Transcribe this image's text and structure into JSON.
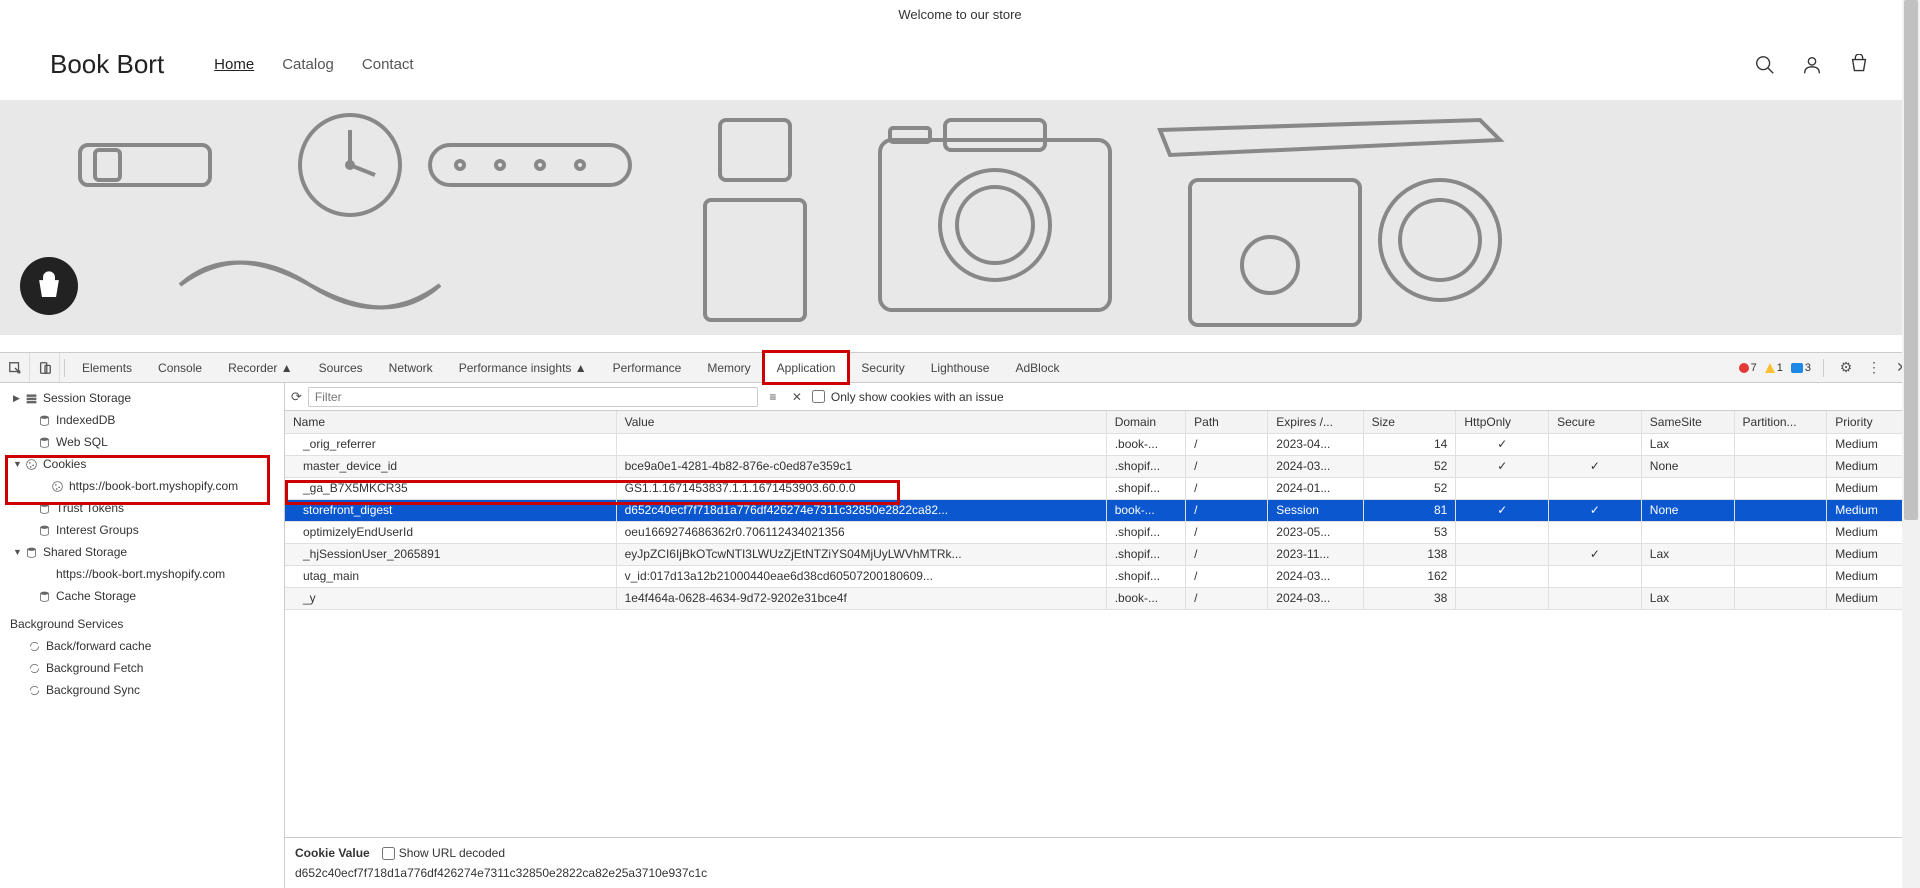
{
  "store": {
    "welcome": "Welcome to our store",
    "title": "Book Bort",
    "nav": [
      "Home",
      "Catalog",
      "Contact"
    ]
  },
  "devtools": {
    "tabs": [
      "Elements",
      "Console",
      "Recorder ▲",
      "Sources",
      "Network",
      "Performance insights ▲",
      "Performance",
      "Memory",
      "Application",
      "Security",
      "Lighthouse",
      "AdBlock"
    ],
    "errors": "7",
    "warnings": "1",
    "messages": "3"
  },
  "sidebar": {
    "items": [
      {
        "label": "Session Storage",
        "indent": 1,
        "arrow": "▶",
        "icon": "storage"
      },
      {
        "label": "IndexedDB",
        "indent": 2,
        "icon": "db"
      },
      {
        "label": "Web SQL",
        "indent": 2,
        "icon": "db"
      },
      {
        "label": "Cookies",
        "indent": 1,
        "arrow": "▼",
        "icon": "cookie"
      },
      {
        "label": "https://book-bort.myshopify.com",
        "indent": 3,
        "icon": "cookie"
      },
      {
        "label": "Trust Tokens",
        "indent": 2,
        "icon": "db"
      },
      {
        "label": "Interest Groups",
        "indent": 2,
        "icon": "db"
      },
      {
        "label": "Shared Storage",
        "indent": 1,
        "arrow": "▼",
        "icon": "db"
      },
      {
        "label": "https://book-bort.myshopify.com",
        "indent": 2,
        "icon": ""
      },
      {
        "label": "Cache Storage",
        "indent": 2,
        "icon": "db"
      }
    ],
    "bg_header": "Background Services",
    "bg_items": [
      {
        "label": "Back/forward cache",
        "icon": "sync"
      },
      {
        "label": "Background Fetch",
        "icon": "sync"
      },
      {
        "label": "Background Sync",
        "icon": "sync"
      }
    ]
  },
  "toolbar": {
    "filter_placeholder": "Filter",
    "only_issues": "Only show cookies with an issue"
  },
  "table": {
    "headers": [
      "Name",
      "Value",
      "Domain",
      "Path",
      "Expires /...",
      "Size",
      "HttpOnly",
      "Secure",
      "SameSite",
      "Partition...",
      "Priority"
    ],
    "rows": [
      {
        "name": "_orig_referrer",
        "value": "",
        "domain": ".book-...",
        "path": "/",
        "expires": "2023-04...",
        "size": "14",
        "httponly": "✓",
        "secure": "",
        "samesite": "Lax",
        "partition": "",
        "priority": "Medium"
      },
      {
        "name": "master_device_id",
        "value": "bce9a0e1-4281-4b82-876e-c0ed87e359c1",
        "domain": ".shopif...",
        "path": "/",
        "expires": "2024-03...",
        "size": "52",
        "httponly": "✓",
        "secure": "✓",
        "samesite": "None",
        "partition": "",
        "priority": "Medium"
      },
      {
        "name": "_ga_B7X5MKCR35",
        "value": "GS1.1.1671453837.1.1.1671453903.60.0.0",
        "domain": ".shopif...",
        "path": "/",
        "expires": "2024-01...",
        "size": "52",
        "httponly": "",
        "secure": "",
        "samesite": "",
        "partition": "",
        "priority": "Medium"
      },
      {
        "name": "storefront_digest",
        "value": "d652c40ecf7f718d1a776df426274e7311c32850e2822ca82...",
        "domain": "book-...",
        "path": "/",
        "expires": "Session",
        "size": "81",
        "httponly": "✓",
        "secure": "✓",
        "samesite": "None",
        "partition": "",
        "priority": "Medium",
        "selected": true
      },
      {
        "name": "optimizelyEndUserId",
        "value": "oeu1669274686362r0.706112434021356",
        "domain": ".shopif...",
        "path": "/",
        "expires": "2023-05...",
        "size": "53",
        "httponly": "",
        "secure": "",
        "samesite": "",
        "partition": "",
        "priority": "Medium"
      },
      {
        "name": "_hjSessionUser_2065891",
        "value": "eyJpZCI6IjBkOTcwNTI3LWUzZjEtNTZiYS04MjUyLWVhMTRk...",
        "domain": ".shopif...",
        "path": "/",
        "expires": "2023-11...",
        "size": "138",
        "httponly": "",
        "secure": "✓",
        "samesite": "Lax",
        "partition": "",
        "priority": "Medium"
      },
      {
        "name": "utag_main",
        "value": "v_id:017d13a12b21000440eae6d38cd60507200180609...",
        "domain": ".shopif...",
        "path": "/",
        "expires": "2024-03...",
        "size": "162",
        "httponly": "",
        "secure": "",
        "samesite": "",
        "partition": "",
        "priority": "Medium"
      },
      {
        "name": "_y",
        "value": "1e4f464a-0628-4634-9d72-9202e31bce4f",
        "domain": ".book-...",
        "path": "/",
        "expires": "2024-03...",
        "size": "38",
        "httponly": "",
        "secure": "",
        "samesite": "Lax",
        "partition": "",
        "priority": "Medium"
      }
    ]
  },
  "detail": {
    "label": "Cookie Value",
    "checkbox": "Show URL decoded",
    "value": "d652c40ecf7f718d1a776df426274e7311c32850e2822ca82e25a3710e937c1c"
  }
}
